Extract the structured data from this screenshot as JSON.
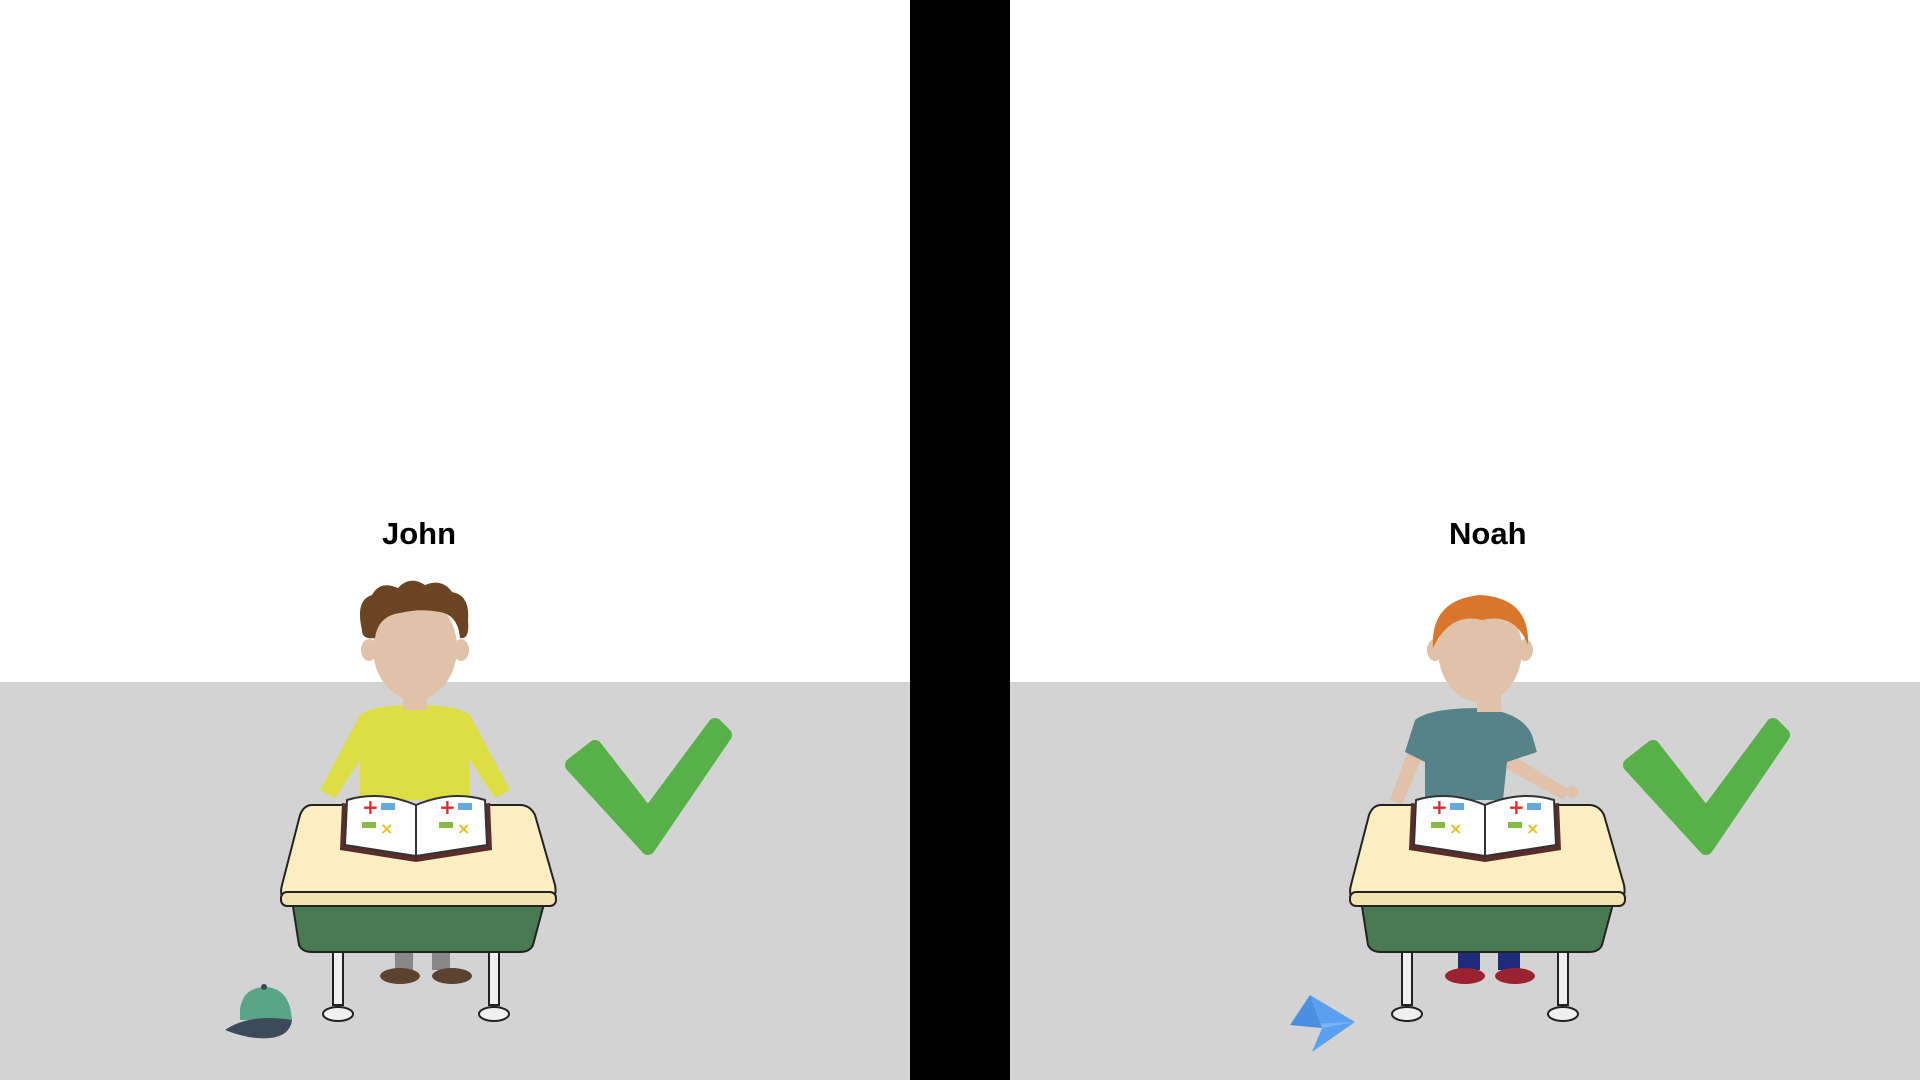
{
  "students": [
    {
      "name": "John",
      "hair_color": "#6b4423",
      "shirt_color": "#dddd44",
      "pants_color": "#888888",
      "shoe_color": "#5c4330",
      "floor_item": "baseball-cap-icon",
      "mark": "checkmark-icon"
    },
    {
      "name": "Noah",
      "hair_color": "#d9762b",
      "shirt_color": "#568288",
      "pants_color": "#1e2a7a",
      "shoe_color": "#9b2230",
      "floor_item": "paper-airplane-icon",
      "mark": "checkmark-icon"
    }
  ],
  "colors": {
    "floor": "#d3d3d3",
    "divider": "#000000",
    "checkmark": "#58b048",
    "desk_top": "#fbeec0",
    "desk_body": "#4a7a52",
    "skin": "#e0c2a8"
  }
}
